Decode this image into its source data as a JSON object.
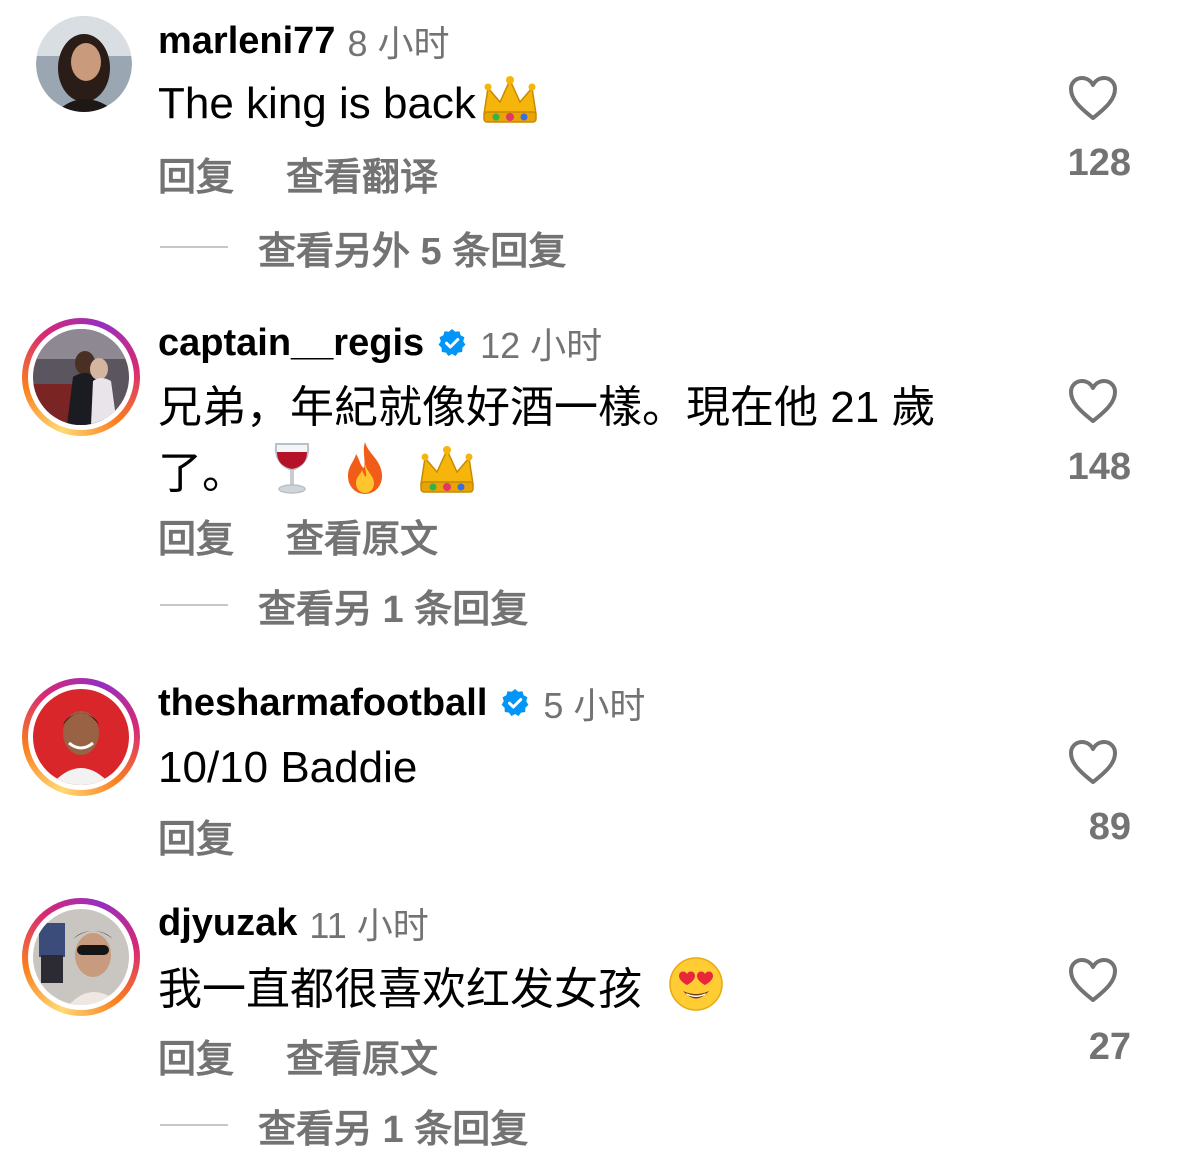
{
  "comments": [
    {
      "username": "marleni77",
      "verified": false,
      "time": "8 小时",
      "text": "The king is back",
      "emoji": [
        "crown"
      ],
      "actions": [
        "回复",
        "查看翻译"
      ],
      "likes": "128",
      "view_replies": "查看另外 5 条回复",
      "has_story_ring": false
    },
    {
      "username": "captain__regis",
      "verified": true,
      "time": "12 小时",
      "text_line1": "兄弟，年紀就像好酒一樣。現在他 21 歲",
      "text_line2": "了。",
      "emoji": [
        "wine-glass",
        "fire",
        "crown"
      ],
      "actions": [
        "回复",
        "查看原文"
      ],
      "likes": "148",
      "view_replies": "查看另 1 条回复",
      "has_story_ring": true
    },
    {
      "username": "thesharmafootball",
      "verified": true,
      "time": "5 小时",
      "text": "10/10 Baddie",
      "actions": [
        "回复"
      ],
      "likes": "89",
      "has_story_ring": true
    },
    {
      "username": "djyuzak",
      "verified": false,
      "time": "11 小时",
      "text": "我一直都很喜欢红发女孩",
      "emoji": [
        "heart-eyes"
      ],
      "actions": [
        "回复",
        "查看原文"
      ],
      "likes": "27",
      "view_replies": "查看另 1 条回复",
      "has_story_ring": true
    }
  ],
  "colors": {
    "secondary_text": "#737373",
    "verified_blue": "#0095f6",
    "divider": "#c7c7c7"
  }
}
